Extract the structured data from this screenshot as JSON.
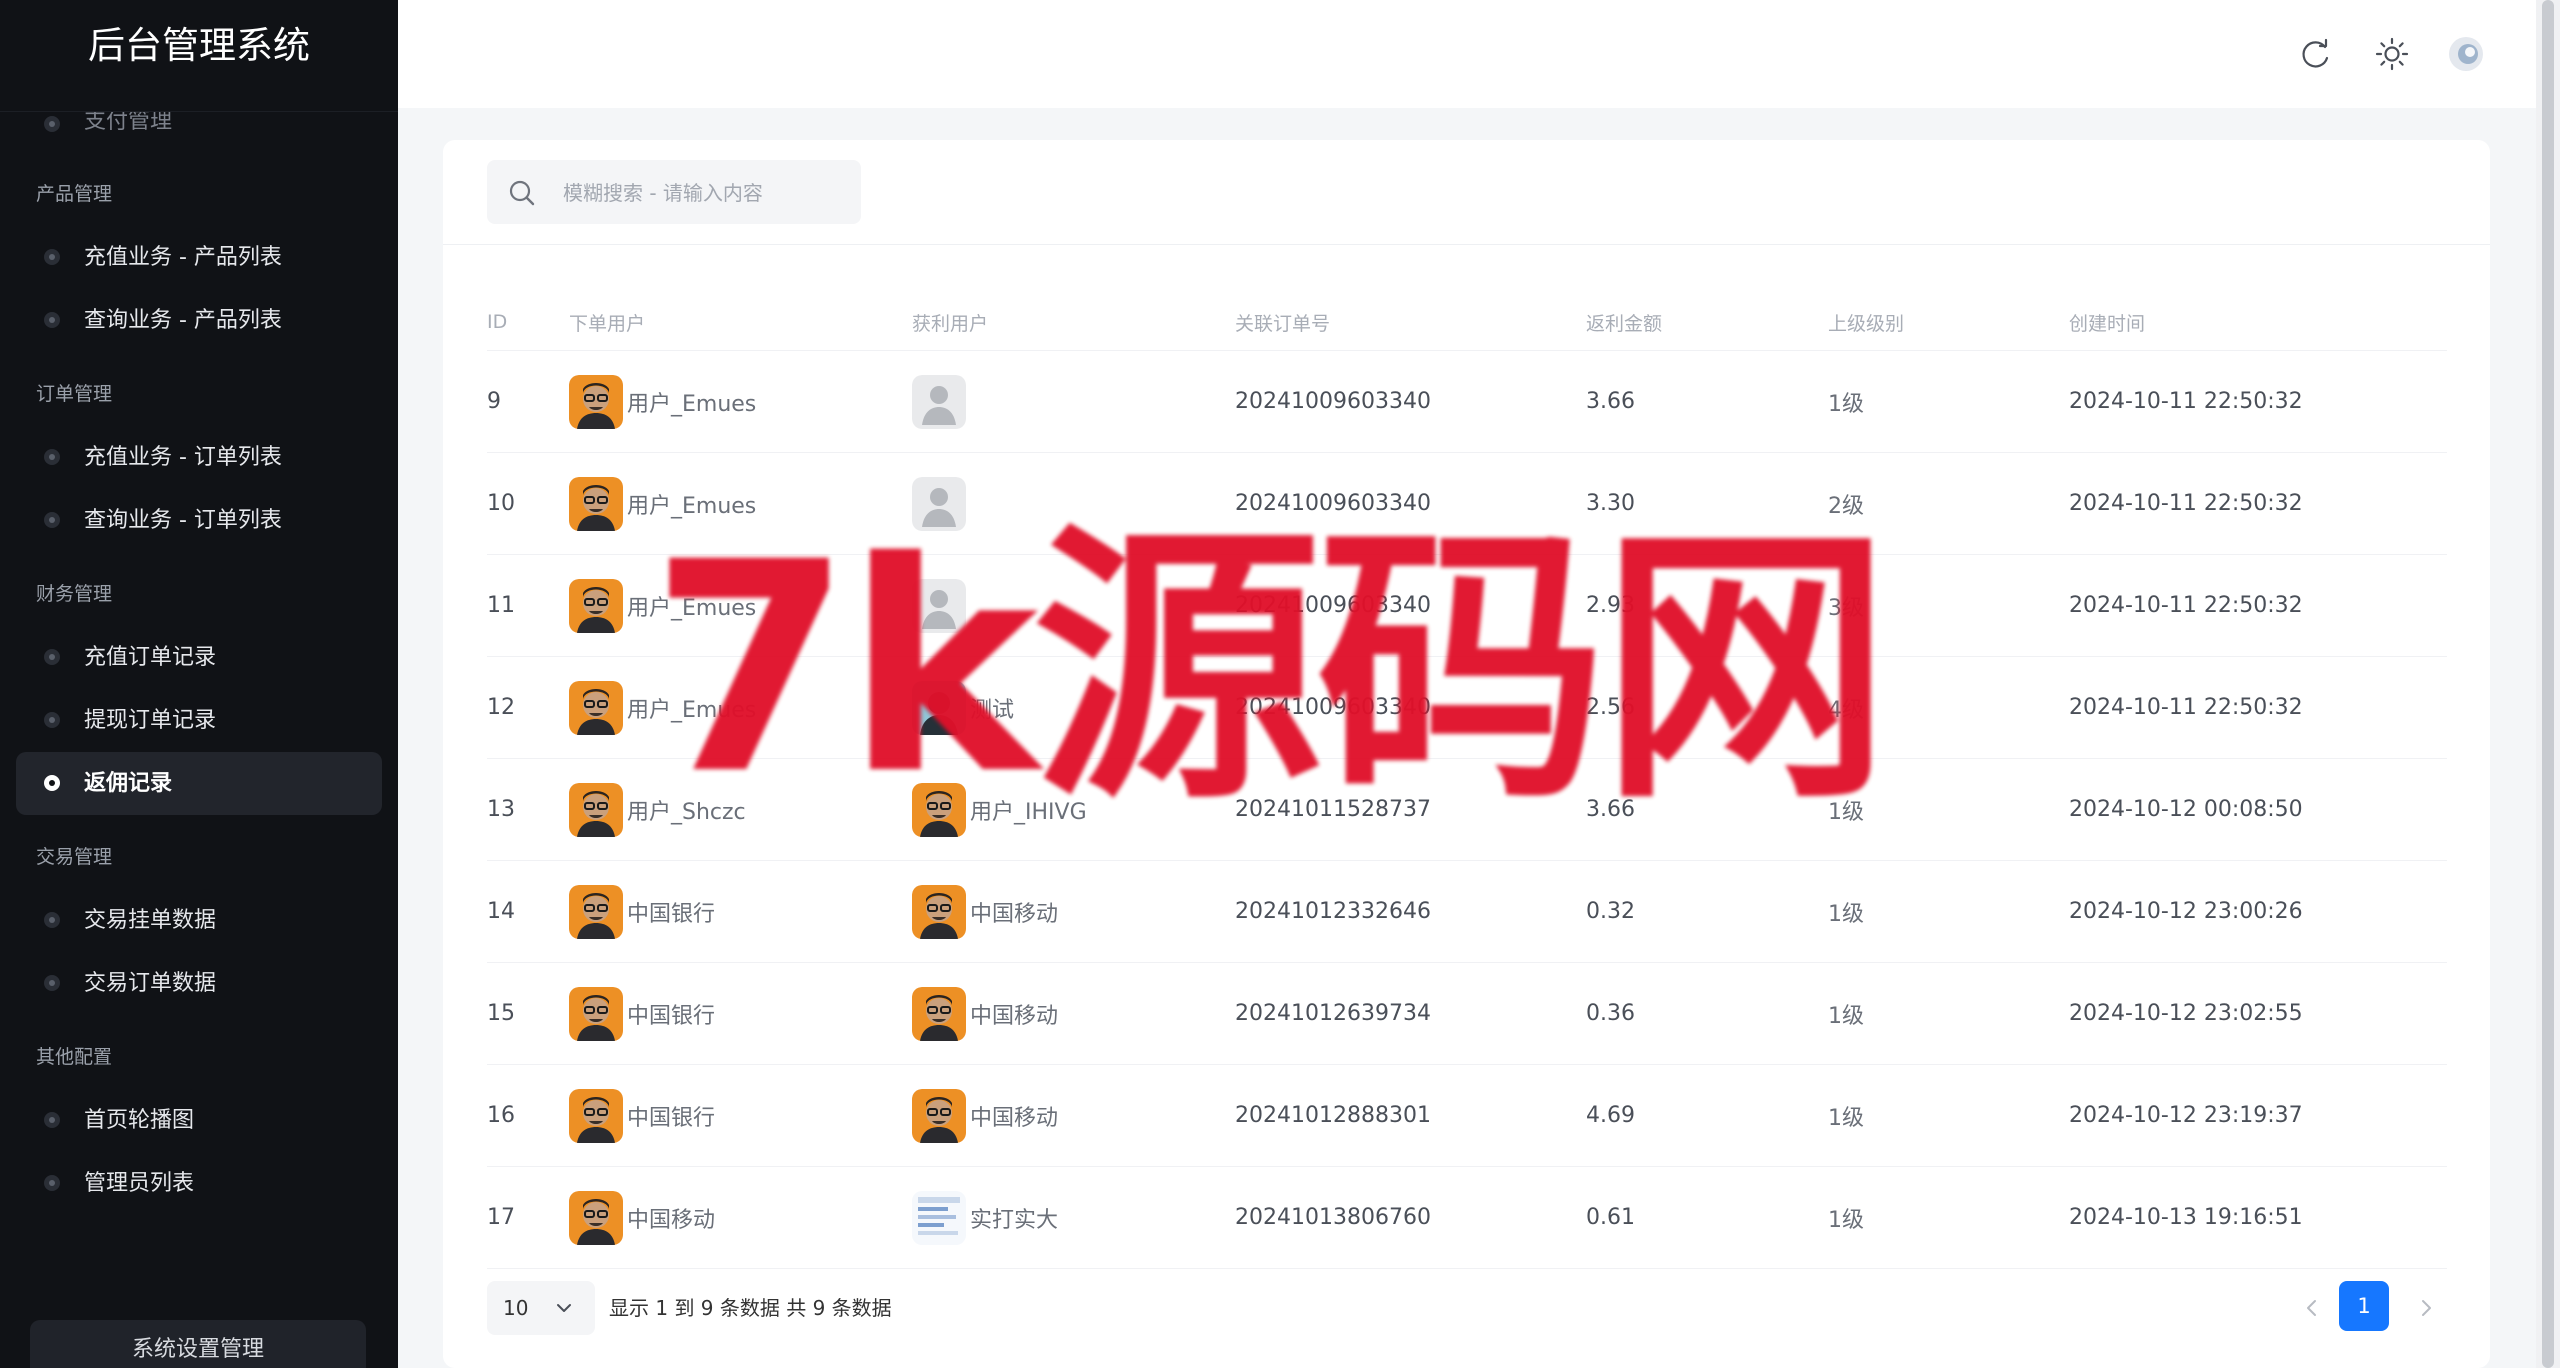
{
  "app": {
    "title": "后台管理系统"
  },
  "sidebar": {
    "cut_item": "支付管理",
    "groups": [
      {
        "title": "产品管理",
        "items": [
          "充值业务 - 产品列表",
          "查询业务 - 产品列表"
        ]
      },
      {
        "title": "订单管理",
        "items": [
          "充值业务 - 订单列表",
          "查询业务 - 订单列表"
        ]
      },
      {
        "title": "财务管理",
        "items": [
          "充值订单记录",
          "提现订单记录",
          "返佣记录"
        ]
      },
      {
        "title": "交易管理",
        "items": [
          "交易挂单数据",
          "交易订单数据"
        ]
      },
      {
        "title": "其他配置",
        "items": [
          "首页轮播图",
          "管理员列表"
        ]
      }
    ],
    "active_item": "返佣记录",
    "bottom_button": "系统设置管理"
  },
  "header": {
    "icons": [
      "refresh-icon",
      "sun-icon",
      "user-avatar"
    ]
  },
  "search": {
    "placeholder": "模糊搜索 - 请输入内容"
  },
  "table": {
    "headers": [
      "ID",
      "下单用户",
      "获利用户",
      "关联订单号",
      "返利金额",
      "上级级别",
      "创建时间"
    ],
    "rows": [
      {
        "id": "9",
        "order_user": "用户_Emues",
        "order_avatar": "photo",
        "profit_user": "",
        "profit_avatar": "default",
        "order_no": "20241009603340",
        "amount": "3.66",
        "level": "1级",
        "created": "2024-10-11 22:50:32"
      },
      {
        "id": "10",
        "order_user": "用户_Emues",
        "order_avatar": "photo",
        "profit_user": "",
        "profit_avatar": "default",
        "order_no": "20241009603340",
        "amount": "3.30",
        "level": "2级",
        "created": "2024-10-11 22:50:32"
      },
      {
        "id": "11",
        "order_user": "用户_Emues",
        "order_avatar": "photo",
        "profit_user": "",
        "profit_avatar": "default",
        "order_no": "20241009603340",
        "amount": "2.93",
        "level": "3级",
        "created": "2024-10-11 22:50:32"
      },
      {
        "id": "12",
        "order_user": "用户_Emues",
        "order_avatar": "photo",
        "profit_user": "测试",
        "profit_avatar": "photo2",
        "order_no": "20241009603340",
        "amount": "2.56",
        "level": "4级",
        "created": "2024-10-11 22:50:32"
      },
      {
        "id": "13",
        "order_user": "用户_Shczc",
        "order_avatar": "photo",
        "profit_user": "用户_IHIVG",
        "profit_avatar": "photo",
        "order_no": "20241011528737",
        "amount": "3.66",
        "level": "1级",
        "created": "2024-10-12 00:08:50"
      },
      {
        "id": "14",
        "order_user": "中国银行",
        "order_avatar": "photo",
        "profit_user": "中国移动",
        "profit_avatar": "photo",
        "order_no": "20241012332646",
        "amount": "0.32",
        "level": "1级",
        "created": "2024-10-12 23:00:26"
      },
      {
        "id": "15",
        "order_user": "中国银行",
        "order_avatar": "photo",
        "profit_user": "中国移动",
        "profit_avatar": "photo",
        "order_no": "20241012639734",
        "amount": "0.36",
        "level": "1级",
        "created": "2024-10-12 23:02:55"
      },
      {
        "id": "16",
        "order_user": "中国银行",
        "order_avatar": "photo",
        "profit_user": "中国移动",
        "profit_avatar": "photo",
        "order_no": "20241012888301",
        "amount": "4.69",
        "level": "1级",
        "created": "2024-10-12 23:19:37"
      },
      {
        "id": "17",
        "order_user": "中国移动",
        "order_avatar": "photo",
        "profit_user": "实打实大",
        "profit_avatar": "doc",
        "order_no": "20241013806760",
        "amount": "0.61",
        "level": "1级",
        "created": "2024-10-13 19:16:51"
      }
    ]
  },
  "pagination": {
    "page_size": "10",
    "info": "显示 1 到 9 条数据 共 9 条数据",
    "current_page": "1"
  },
  "watermark": {
    "text": "7k源码网"
  },
  "colors": {
    "sidebar_bg": "#101216",
    "accent": "#1677ff",
    "watermark": "#e0102a"
  }
}
